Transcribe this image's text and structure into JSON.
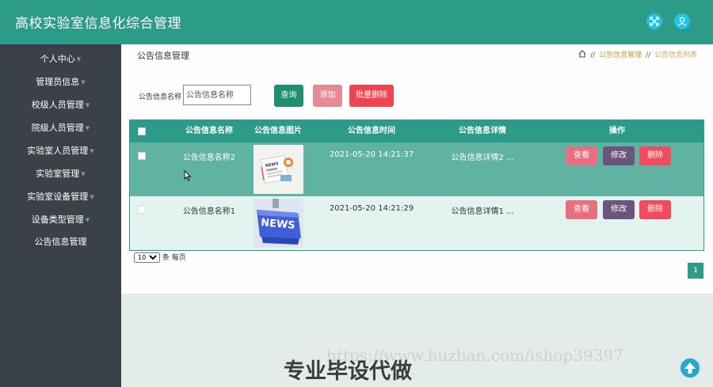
{
  "app": {
    "title": "高校实验室信息化综合管理"
  },
  "header_icons": [
    "fullscreen-icon",
    "user-icon"
  ],
  "sidebar": {
    "items": [
      {
        "label": "个人中心",
        "has_caret": true
      },
      {
        "label": "管理员信息",
        "has_caret": true
      },
      {
        "label": "校级人员管理",
        "has_caret": true
      },
      {
        "label": "院级人员管理",
        "has_caret": true
      },
      {
        "label": "实验室人员管理",
        "has_caret": true
      },
      {
        "label": "实验室管理",
        "has_caret": true
      },
      {
        "label": "实验室设备管理",
        "has_caret": true
      },
      {
        "label": "设备类型管理",
        "has_caret": true
      },
      {
        "label": "公告信息管理",
        "has_caret": false
      }
    ]
  },
  "page": {
    "title": "公告信息管理"
  },
  "breadcrumb": {
    "items": [
      "公告信息管理",
      "公告信息列表"
    ],
    "separator": "//"
  },
  "search": {
    "label": "公告信息名称",
    "placeholder": "公告信息名称",
    "value": ""
  },
  "toolbar": {
    "query_label": "查询",
    "add_label": "添加",
    "batch_delete_label": "批量删除"
  },
  "table": {
    "columns": [
      "公告信息名称",
      "公告信息图片",
      "公告信息时间",
      "公告信息详情",
      "操作"
    ],
    "rows": [
      {
        "name": "公告信息名称2",
        "time": "2021-05-20 14:21:37",
        "detail": "公告信息详情2 ...",
        "image_icon": "news-document-image"
      },
      {
        "name": "公告信息名称1",
        "time": "2021-05-20 14:21:29",
        "detail": "公告信息详情1 ...",
        "image_icon": "news-key-image"
      }
    ],
    "actions": {
      "view": "查看",
      "edit": "修改",
      "delete": "删除"
    }
  },
  "pagination": {
    "page_size": "10",
    "page_size_options": [
      "10"
    ],
    "per_page_label": "条 每页",
    "current_page": "1"
  },
  "watermark": {
    "url": "https://www.huzhan.com/ishop39397",
    "text": "专业毕设代做"
  },
  "colors": {
    "primary": "#2c9b87",
    "sidebar_bg": "#3a4148",
    "query": "#1e8f6f",
    "add": "#e88a95",
    "batch_delete": "#ef4550",
    "view": "#e8707e",
    "edit": "#6b557c",
    "delete": "#f24c5c"
  }
}
